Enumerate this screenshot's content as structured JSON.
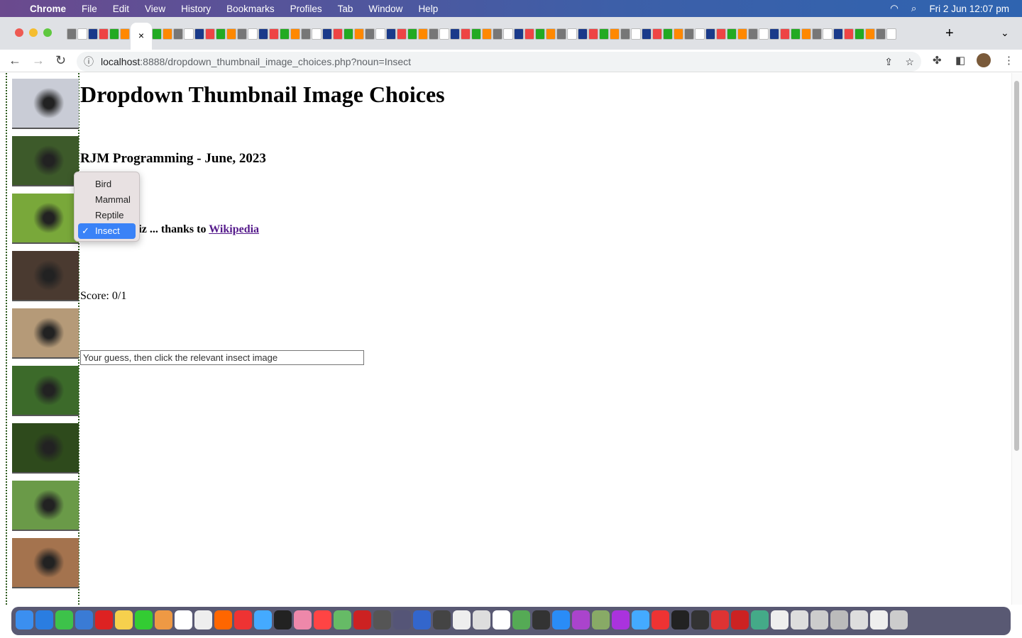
{
  "menubar": {
    "app": "Chrome",
    "items": [
      "File",
      "Edit",
      "View",
      "History",
      "Bookmarks",
      "Profiles",
      "Tab",
      "Window",
      "Help"
    ],
    "datetime": "Fri 2 Jun  12:07 pm"
  },
  "browser": {
    "url_host": "localhost",
    "url_rest": ":8888/dropdown_thumbnail_image_choices.php?noun=Insect",
    "active_tab_close": "×",
    "new_tab": "+"
  },
  "page": {
    "title": "Dropdown Thumbnail Image Choices",
    "subtitle": "RJM Programming - June, 2023",
    "quiz_text": "Quiz ... thanks to ",
    "link": "Wikipedia",
    "score": "Score: 0/1",
    "guess_placeholder": "Your guess, then click the relevant insect image",
    "thumbnail_colors": [
      "#c9ccd6",
      "#3d5a2a",
      "#79a83a",
      "#4a3a30",
      "#b59a78",
      "#3c6a2a",
      "#2e4a1c",
      "#6a9a48",
      "#a4734e"
    ]
  },
  "dropdown": {
    "options": [
      "Bird",
      "Mammal",
      "Reptile",
      "Insect"
    ],
    "selected": "Insect",
    "check": "✓",
    "accent": "#3a82f7"
  }
}
